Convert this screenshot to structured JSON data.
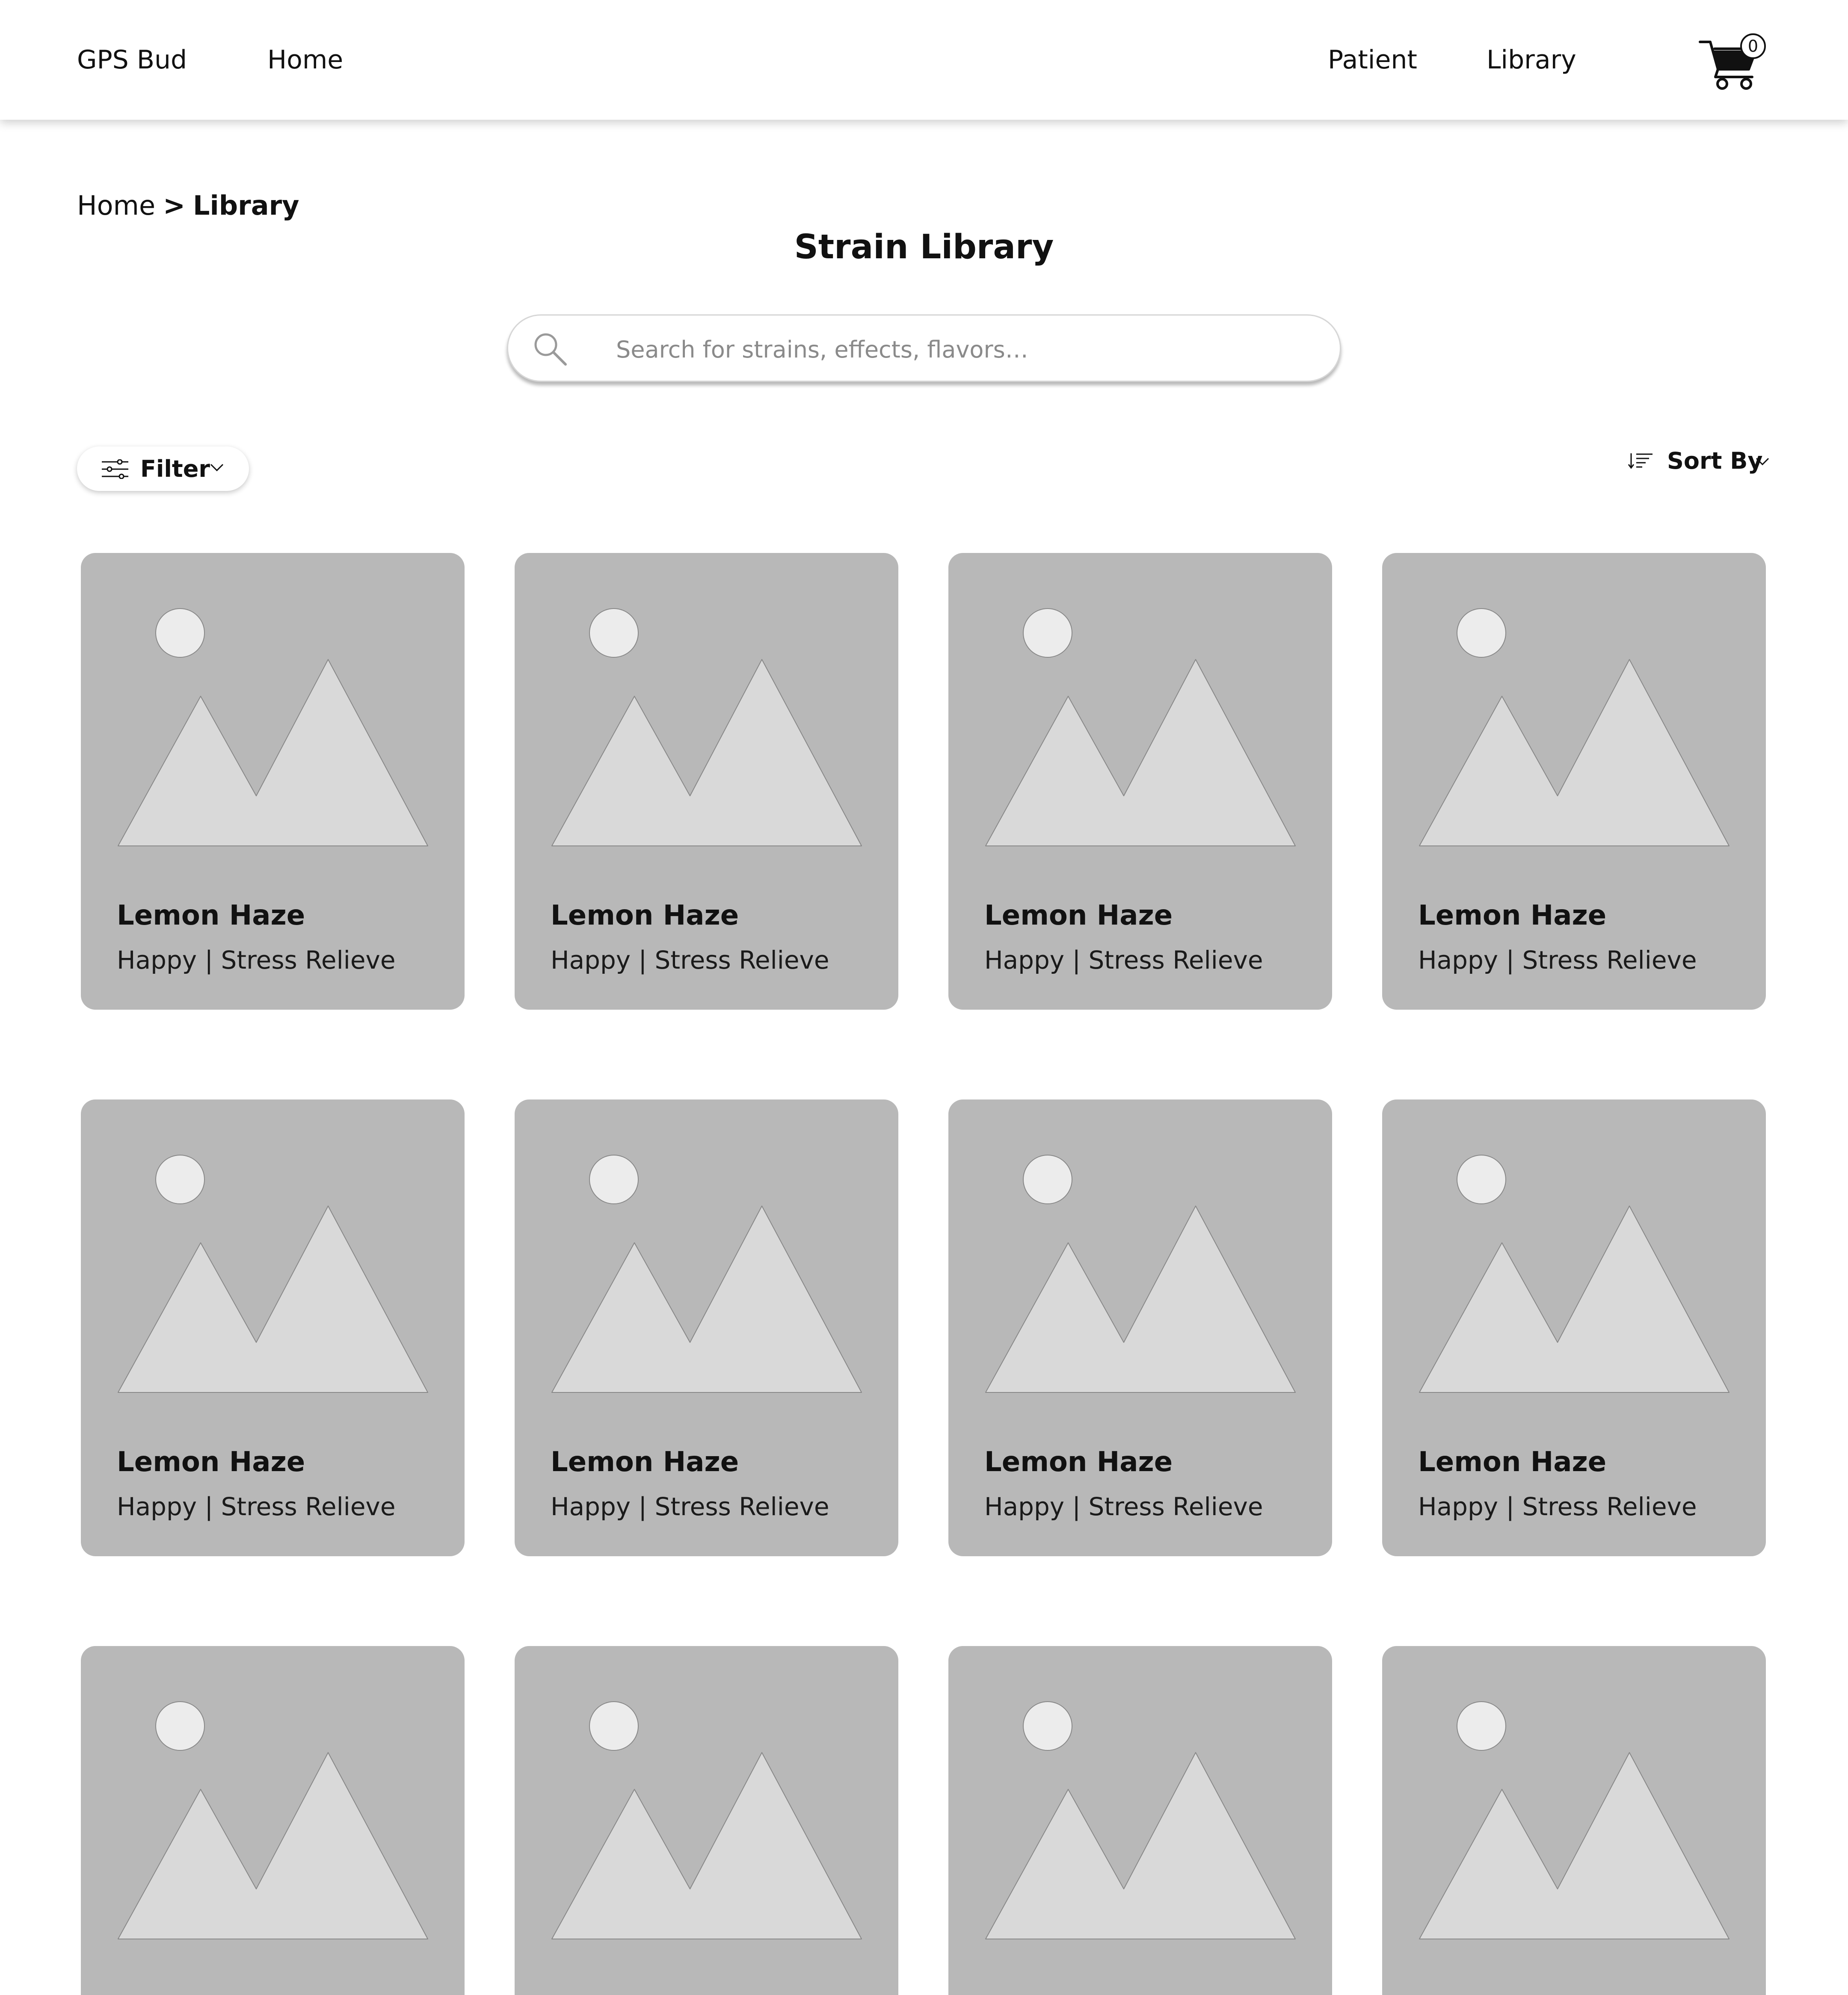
{
  "nav": {
    "brand": "GPS Bud",
    "home": "Home",
    "patient": "Patient",
    "library": "Library",
    "cart_count": "0"
  },
  "breadcrumb": {
    "home": "Home",
    "separator": ">",
    "current": "Library"
  },
  "page": {
    "title": "Strain Library"
  },
  "search": {
    "placeholder": "Search for strains, effects, flavors…",
    "value": ""
  },
  "controls": {
    "filter_label": "Filter",
    "sort_label": "Sort By"
  },
  "cards": [
    {
      "name": "Lemon Haze",
      "tags": "Happy | Stress Relieve"
    },
    {
      "name": "Lemon Haze",
      "tags": "Happy | Stress Relieve"
    },
    {
      "name": "Lemon Haze",
      "tags": "Happy | Stress Relieve"
    },
    {
      "name": "Lemon Haze",
      "tags": "Happy | Stress Relieve"
    },
    {
      "name": "Lemon Haze",
      "tags": "Happy | Stress Relieve"
    },
    {
      "name": "Lemon Haze",
      "tags": "Happy | Stress Relieve"
    },
    {
      "name": "Lemon Haze",
      "tags": "Happy | Stress Relieve"
    },
    {
      "name": "Lemon Haze",
      "tags": "Happy | Stress Relieve"
    },
    {
      "name": "",
      "tags": ""
    },
    {
      "name": "",
      "tags": ""
    },
    {
      "name": "",
      "tags": ""
    },
    {
      "name": "",
      "tags": ""
    }
  ],
  "icons": {
    "cart": "cart-icon",
    "search": "search-icon",
    "filter": "sliders-icon",
    "sort": "sort-icon",
    "dropdown": "chevron-down-icon",
    "placeholder": "image-placeholder-icon"
  },
  "colors": {
    "card_background": "#b8b8b8",
    "placeholder_shape": "#d9d9d9",
    "placeholder_sun": "#ececec",
    "text": "#111111"
  }
}
